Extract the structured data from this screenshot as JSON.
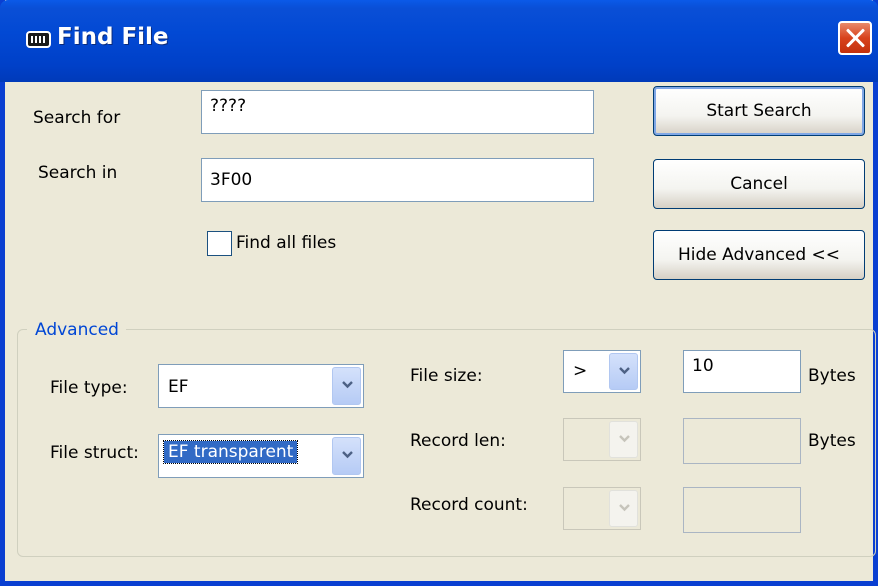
{
  "window": {
    "title": "Find File"
  },
  "search": {
    "search_for_label": "Search for",
    "search_for_value": "????",
    "search_in_label": "Search in",
    "search_in_value": "3F00",
    "find_all_label": "Find all files",
    "find_all_checked": false
  },
  "buttons": {
    "start_search": "Start Search",
    "cancel": "Cancel",
    "hide_advanced": "Hide Advanced <<"
  },
  "advanced": {
    "title": "Advanced",
    "file_type_label": "File type:",
    "file_type_value": "EF",
    "file_struct_label": "File struct:",
    "file_struct_value": "EF transparent",
    "file_size_label": "File size:",
    "file_size_op": ">",
    "file_size_value": "10",
    "file_size_unit": "Bytes",
    "record_len_label": "Record len:",
    "record_len_op": "",
    "record_len_value": "",
    "record_len_unit": "Bytes",
    "record_count_label": "Record count:",
    "record_count_op": "",
    "record_count_value": ""
  },
  "colors": {
    "titlebar": "#0a4fd6",
    "dialog_bg": "#ece9d8",
    "group_title": "#0046d5",
    "close": "#d8431d"
  },
  "icons": [
    "app-icon",
    "close-icon",
    "chevron-down-icon"
  ]
}
